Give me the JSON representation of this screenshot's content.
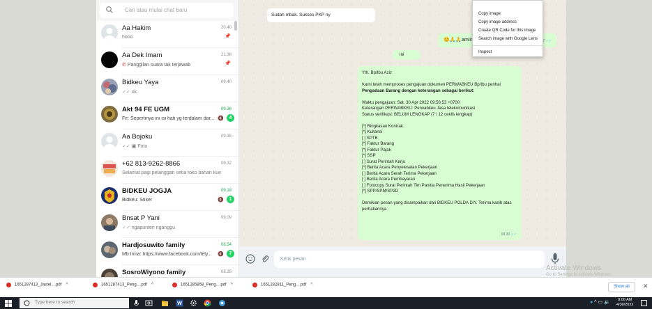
{
  "search": {
    "placeholder": "Cari atau mulai chat baru"
  },
  "chats": [
    {
      "name": "Aa Hakim",
      "time": "20.40",
      "preview": "hooo",
      "pinned": true
    },
    {
      "name": "Aa Dek Imam",
      "time": "21.36",
      "preview": "Panggilan suara tak terjawab",
      "pinned": true
    },
    {
      "name": "Bidkeu Yaya",
      "time": "09.40",
      "preview": "ok."
    },
    {
      "name": "Akt 94 FE UGM",
      "time": "09.36",
      "preview": "Fe: Sepertinya ini isi hati yg terdalam dar...",
      "unread": "4"
    },
    {
      "name": "Aa Bojoku",
      "time": "09.35",
      "preview": "Foto"
    },
    {
      "name": "+62 813-9262-8866",
      "time": "09.32",
      "preview": "Selamat pagi pelanggan setia toko bahan kue for..."
    },
    {
      "name": "BIDKEU JOGJA",
      "time": "09.18",
      "preview": "Bidkeu: Stiker",
      "unread": "1"
    },
    {
      "name": "Bnsat P Yani",
      "time": "09.09",
      "preview": "ngapunten nganggu"
    },
    {
      "name": "Hardjosuwito family",
      "time": "08.54",
      "preview": "Mb Irma: https://www.facebook.com/lely...",
      "unread": "7"
    },
    {
      "name": "SosroWiyono family",
      "time": "08.35",
      "preview": ""
    }
  ],
  "conversation": {
    "top_bubble": "Sudah mbak. Sukses PKP ny",
    "amin_bubble": "amiin.. matur nuwun",
    "amin_time": "09.27",
    "ini_bubble": "ini",
    "main_lines": [
      "Yth. Bp/Ibu Aziz",
      "",
      "Kami telah memproses pengajuan dokumen PERWABKEU Bp/Ibu perihal",
      "Pengadaan Barang dengan keterangan sebagai berikut:",
      "",
      "Waktu pengajuan: Sat, 30 Apr 2022 09:56:53 +0700",
      "Keterangan PERWABKEU: Perwabkeu Jasa telekomunikasi",
      "Status verifikasi: BELUM LENGKAP (7 / 12 ceklis lengkap)",
      "",
      "[*] Ringkasan Kontrak",
      "[*] Kuitansi",
      "[ ] SPTB",
      "[*] Faktur Barang",
      "[*] Faktur Pajak",
      "[*] SSP",
      "[ ] Surat Perintah Kerja",
      "[*] Berita Acara Penyelesaian Pekerjaan",
      "[ ] Berita Acara Serah Terima Pekerjaan",
      "[ ] Berita Acara Pembayaran",
      "[ ] Fotocopy Surat Perintah Tim Panitia Penerima Hasil Pekerjaan",
      "[*] SPP/SPM/SP2D",
      "",
      "Demikian pesan yang disampaikan dari BIDKEU POLDA DIY. Terima kasih atas",
      "perhatiannya"
    ],
    "main_time": "09.30",
    "compose_placeholder": "Ketik pesan"
  },
  "context_menu": {
    "items": [
      "Copy image",
      "Copy image address",
      "Create QR Code for this image",
      "Search image with Google Lens",
      "Inspect"
    ]
  },
  "watermark": {
    "title": "Activate Windows",
    "subtitle": "Go to Settings to activate Windows."
  },
  "downloads": {
    "items": [
      "1651287413_Jastel....pdf",
      "1651287413_Peng....pdf",
      "1651285858_Peng....pdf",
      "1651282811_Peng....pdf"
    ],
    "show_all": "Show all"
  },
  "taskbar": {
    "search_placeholder": "Type here to search",
    "time": "9:00 AM",
    "date": "4/30/2022"
  }
}
